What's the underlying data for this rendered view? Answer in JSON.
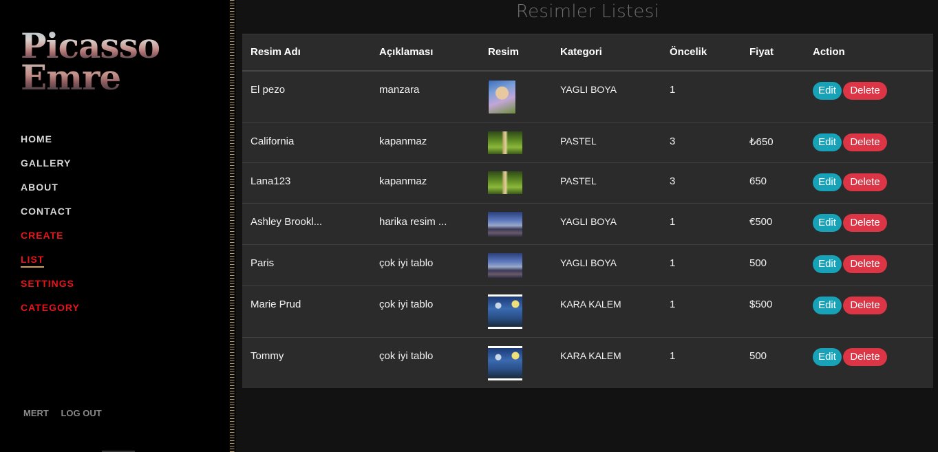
{
  "brand": {
    "line1": "Picasso",
    "line2": "Emre"
  },
  "nav": [
    {
      "label": "HOME"
    },
    {
      "label": "GALLERY"
    },
    {
      "label": "ABOUT"
    },
    {
      "label": "CONTACT"
    },
    {
      "label": "CREATE"
    },
    {
      "label": "LIST"
    },
    {
      "label": "SETTINGS"
    },
    {
      "label": "CATEGORY"
    }
  ],
  "user": {
    "name": "MERT",
    "logout": "LOG OUT"
  },
  "page": {
    "title": "Resimler Listesi"
  },
  "table": {
    "headers": [
      "Resim Adı",
      "Açıklaması",
      "Resim",
      "Kategori",
      "Öncelik",
      "Fiyat",
      "Action"
    ],
    "edit_label": "Edit",
    "delete_label": "Delete",
    "rows": [
      {
        "name": "El pezo",
        "desc": "manzara",
        "image": "portrait",
        "category": "YAGLI BOYA",
        "priority": "1",
        "price": ""
      },
      {
        "name": "California",
        "desc": "kapanmaz",
        "image": "forest",
        "category": "PASTEL",
        "priority": "3",
        "price": "₺650"
      },
      {
        "name": "Lana123",
        "desc": "kapanmaz",
        "image": "forest",
        "category": "PASTEL",
        "priority": "3",
        "price": "650"
      },
      {
        "name": "Ashley Brookl...",
        "desc": "harika resim ...",
        "image": "city",
        "category": "YAGLI BOYA",
        "priority": "1",
        "price": "€500"
      },
      {
        "name": "Paris",
        "desc": "çok iyi tablo",
        "image": "city",
        "category": "YAGLI BOYA",
        "priority": "1",
        "price": "500"
      },
      {
        "name": "Marie Prud",
        "desc": "çok iyi tablo",
        "image": "starry",
        "category": "KARA KALEM",
        "priority": "1",
        "price": "$500"
      },
      {
        "name": "Tommy",
        "desc": "çok iyi tablo",
        "image": "starry",
        "category": "KARA KALEM",
        "priority": "1",
        "price": "500"
      }
    ]
  },
  "colors": {
    "accent_red": "#e8141b",
    "edit": "#17a2b8",
    "delete": "#dc3545",
    "underline": "#d6a24a"
  }
}
